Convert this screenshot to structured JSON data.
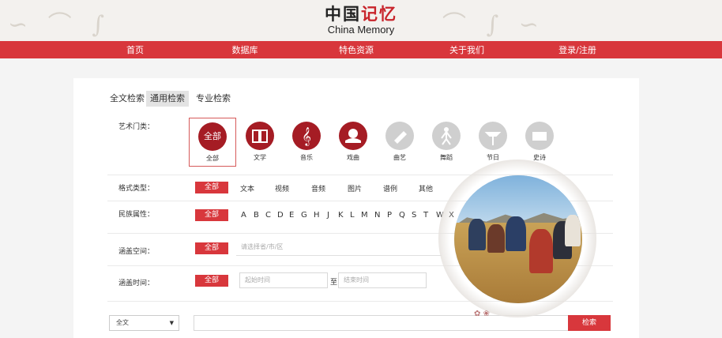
{
  "header": {
    "logo_cn_black": "中国",
    "logo_cn_red": "记忆",
    "logo_en": "China Memory"
  },
  "nav": {
    "items": [
      "首页",
      "数据库",
      "特色资源",
      "关于我们",
      "登录/注册"
    ]
  },
  "search_tabs": [
    "全文检索",
    "通用检索",
    "专业检索"
  ],
  "active_tab": "通用检索",
  "art_category": {
    "label": "艺术门类：",
    "items": [
      {
        "name": "全部",
        "circle_text": "全部",
        "icon": "all-icon",
        "state": "selected"
      },
      {
        "name": "文学",
        "icon": "book-icon",
        "state": "active"
      },
      {
        "name": "音乐",
        "icon": "treble-clef-icon",
        "state": "active"
      },
      {
        "name": "戏曲",
        "icon": "opera-mask-icon",
        "state": "active"
      },
      {
        "name": "曲艺",
        "icon": "folk-art-icon",
        "state": "disabled"
      },
      {
        "name": "舞蹈",
        "icon": "dance-icon",
        "state": "disabled"
      },
      {
        "name": "节日",
        "icon": "lantern-icon",
        "state": "disabled"
      },
      {
        "name": "史诗",
        "icon": "scroll-icon",
        "state": "disabled"
      }
    ]
  },
  "format_type": {
    "label": "格式类型：",
    "all": "全部",
    "options": [
      "文本",
      "视频",
      "音频",
      "图片",
      "谱例",
      "其他"
    ]
  },
  "ethnicity": {
    "label": "民族属性：",
    "all": "全部",
    "letters": [
      "A",
      "B",
      "C",
      "D",
      "E",
      "G",
      "H",
      "J",
      "K",
      "L",
      "M",
      "N",
      "P",
      "Q",
      "S",
      "T",
      "W",
      "X"
    ]
  },
  "coverage_space": {
    "label": "涵盖空间：",
    "all": "全部",
    "placeholder": "请选择省/市/区"
  },
  "coverage_time": {
    "label": "涵盖时间：",
    "all": "全部",
    "start_placeholder": "起始时间",
    "to": "至",
    "end_placeholder": "结束时间"
  },
  "bottom_search": {
    "select_value": "全文",
    "button": "检索"
  },
  "colors": {
    "brand_red": "#d8373c",
    "dark_red": "#a51c24",
    "disabled_grey": "#cfcfcf"
  }
}
